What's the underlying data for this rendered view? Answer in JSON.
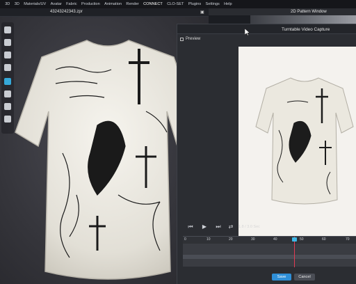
{
  "menu": [
    "3D",
    "3D",
    "Materials/UV",
    "Avatar",
    "Fabric",
    "Production",
    "Animation",
    "Render",
    "CONNECT",
    "CLO-SET",
    "Plugins",
    "Settings",
    "Help"
  ],
  "file": {
    "name": "43243242343.zpr"
  },
  "pattern_window": {
    "title": "2D Pattern Window"
  },
  "dialog": {
    "title": "Turntable Video Capture",
    "preview_label": "Preview",
    "time_readout": "1.8 / 3.0 Sec",
    "ruler_ticks": [
      "0",
      "10",
      "20",
      "30",
      "40",
      "50",
      "60",
      "70"
    ],
    "save_label": "Save",
    "cancel_label": "Cancel"
  },
  "colors": {
    "accent": "#3fb7e5",
    "playhead": "#e23a53",
    "save": "#2f8fd8"
  },
  "icons": [
    "rewind-icon",
    "play-icon",
    "fast-forward-icon",
    "loop-icon",
    "cursor-icon"
  ]
}
